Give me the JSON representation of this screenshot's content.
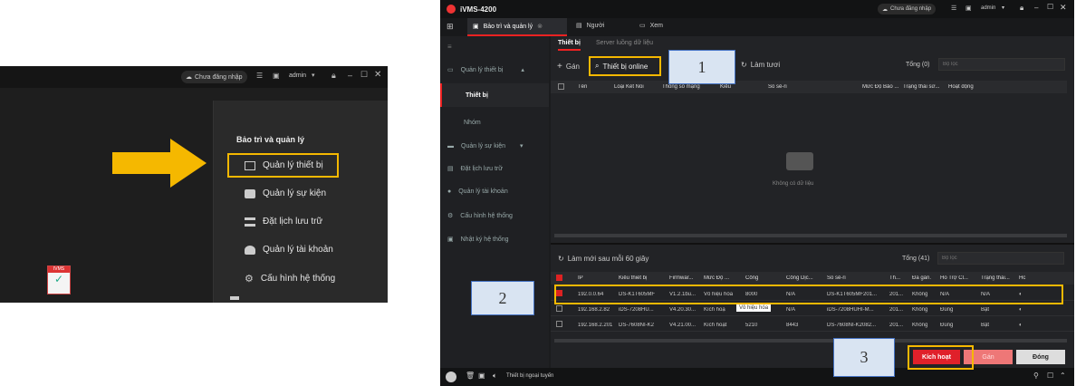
{
  "left": {
    "title": {
      "login": "Chưa đăng nhập",
      "user": "admin"
    },
    "menu_title": "Bảo trì và quản lý",
    "items": [
      "Quản lý thiết bị",
      "Quản lý sự kiện",
      "Đặt lịch lưu trữ",
      "Quản lý tài khoản",
      "Cấu hình hệ thống"
    ],
    "calendar": "IVMS"
  },
  "app": {
    "name": "iVMS-4200",
    "login": "Chưa đăng nhập",
    "user": "admin",
    "tabs": [
      "Bảo trì và quản lý",
      "Người",
      "Xem"
    ],
    "sidebar": [
      "Quản lý thiết bị",
      "Thiết bị",
      "Nhóm",
      "Quản lý sự kiện",
      "Đặt lịch lưu trữ",
      "Quản lý tài khoản",
      "Cấu hình hệ thống",
      "Nhật ký hệ thống"
    ],
    "subtabs": [
      "Thiết bị",
      "Server luồng dữ liệu"
    ],
    "toolbar": {
      "add": "Gán",
      "online": "Thiết bị online",
      "refresh": "Làm tươi",
      "total": "Tổng (0)",
      "filter": "Bộ lọc"
    },
    "top_headers": [
      "Tên",
      "Loại Kết Nối",
      "Thông số mạng",
      "Kiểu",
      "Số sê-ri",
      "Mức Độ Bảo ...",
      "Trạng thái sử...",
      "Hoạt động"
    ],
    "empty": "Không có dữ liệu",
    "online": {
      "refresh": "Làm mới sau mỗi 60 giây",
      "total": "Tổng (41)",
      "filter": "Bộ lọc"
    },
    "headers": [
      "IP",
      "Kiểu thiết bị",
      "Firmwar...",
      "Mức Độ ...",
      "Cổng",
      "Cổng Dịc...",
      "Số sê-ri",
      "Th...",
      "Đã gán.",
      "Hỗ Trợ Cl...",
      "Trạng thái...",
      "Hc"
    ],
    "rows": [
      [
        "192.0.0.64",
        "DS-K1T605MF",
        "V1.2.1bu...",
        "Vô hiệu hóa",
        "8000",
        "N/A",
        "DS-K1T605MF201...",
        "201...",
        "Không",
        "N/A",
        "N/A"
      ],
      [
        "192.168.2.82",
        "iDS-7208HU...",
        "V4.20.30...",
        "Kích hoạ",
        "80",
        "N/A",
        "iDS-7208HUHI-M...",
        "201...",
        "Không",
        "Đúng",
        "Bật"
      ],
      [
        "192.168.2.201",
        "DS-7608NI-K2",
        "V4.21.00...",
        "Kích hoạt",
        "5210",
        "8443",
        "DS-7608NI-K2082...",
        "201...",
        "Không",
        "Đúng",
        "Bật"
      ]
    ],
    "tooltip": "Vô hiệu hóa",
    "buttons": {
      "activate": "Kích hoạt",
      "assign": "Gán",
      "close": "Đóng"
    },
    "status": "Thiết bị ngoại tuyến"
  },
  "annotations": [
    "1",
    "2",
    "3"
  ]
}
